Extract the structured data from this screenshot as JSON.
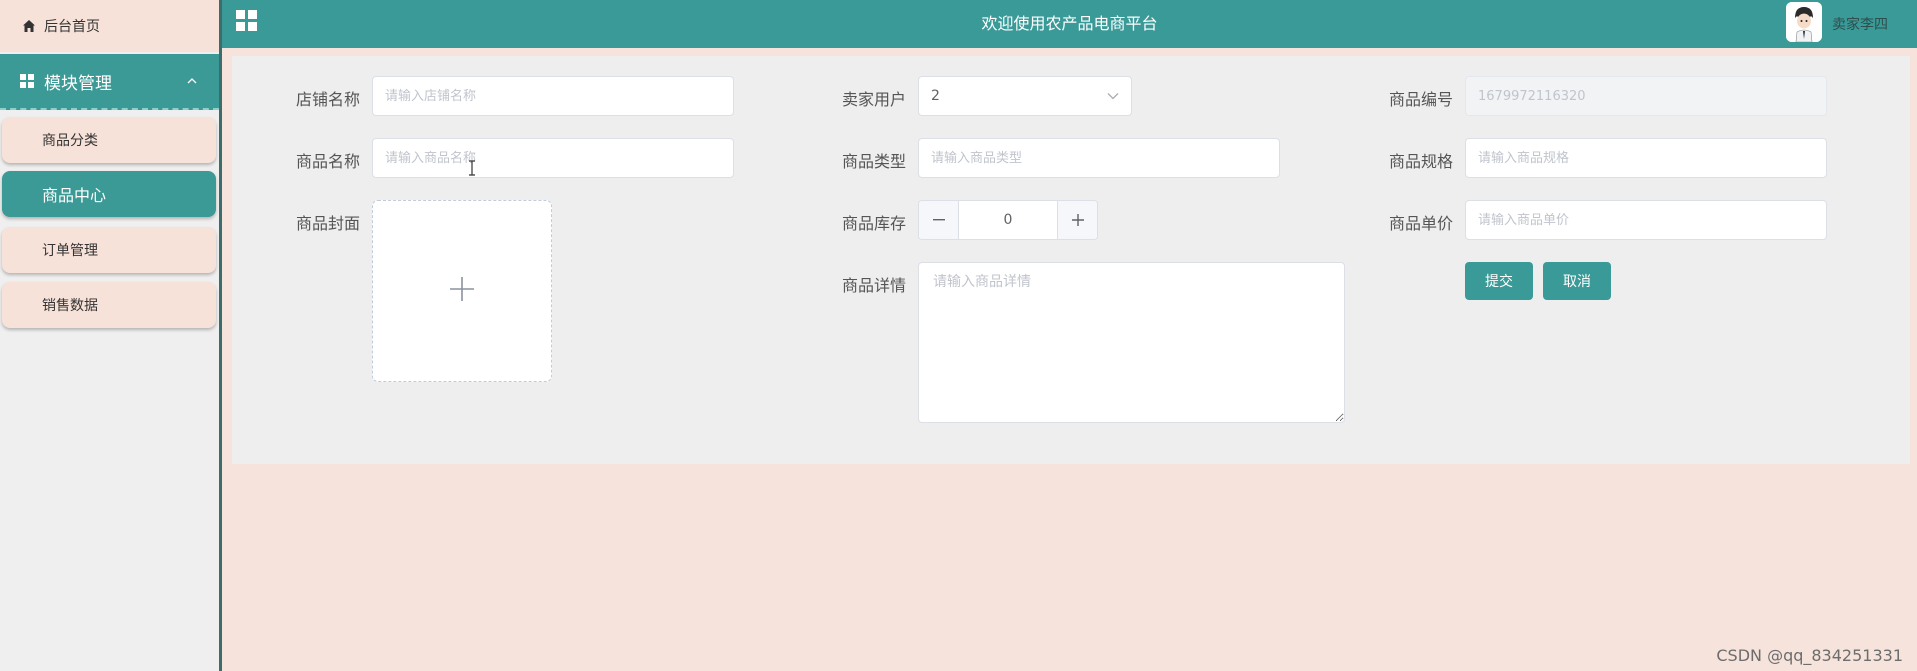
{
  "sidebar": {
    "home_label": "后台首页",
    "module_label": "模块管理",
    "items": [
      {
        "label": "商品分类",
        "active": false
      },
      {
        "label": "商品中心",
        "active": true
      },
      {
        "label": "订单管理",
        "active": false
      },
      {
        "label": "销售数据",
        "active": false
      }
    ]
  },
  "header": {
    "title": "欢迎使用农产品电商平台",
    "user_name": "卖家李四",
    "accent_color": "#3a9a98"
  },
  "form": {
    "shop_name": {
      "label": "店铺名称",
      "placeholder": "请输入店铺名称",
      "value": ""
    },
    "seller_user": {
      "label": "卖家用户",
      "value": "2"
    },
    "product_no": {
      "label": "商品编号",
      "value": "1679972116320"
    },
    "product_name": {
      "label": "商品名称",
      "placeholder": "请输入商品名称",
      "value": ""
    },
    "product_type": {
      "label": "商品类型",
      "placeholder": "请输入商品类型",
      "value": ""
    },
    "product_spec": {
      "label": "商品规格",
      "placeholder": "请输入商品规格",
      "value": ""
    },
    "product_cover": {
      "label": "商品封面"
    },
    "stock": {
      "label": "商品库存",
      "value": "0"
    },
    "unit_price": {
      "label": "商品单价",
      "placeholder": "请输入商品单价",
      "value": ""
    },
    "details": {
      "label": "商品详情",
      "placeholder": "请输入商品详情",
      "value": ""
    },
    "submit_label": "提交",
    "cancel_label": "取消"
  },
  "watermark": "CSDN @qq_834251331"
}
